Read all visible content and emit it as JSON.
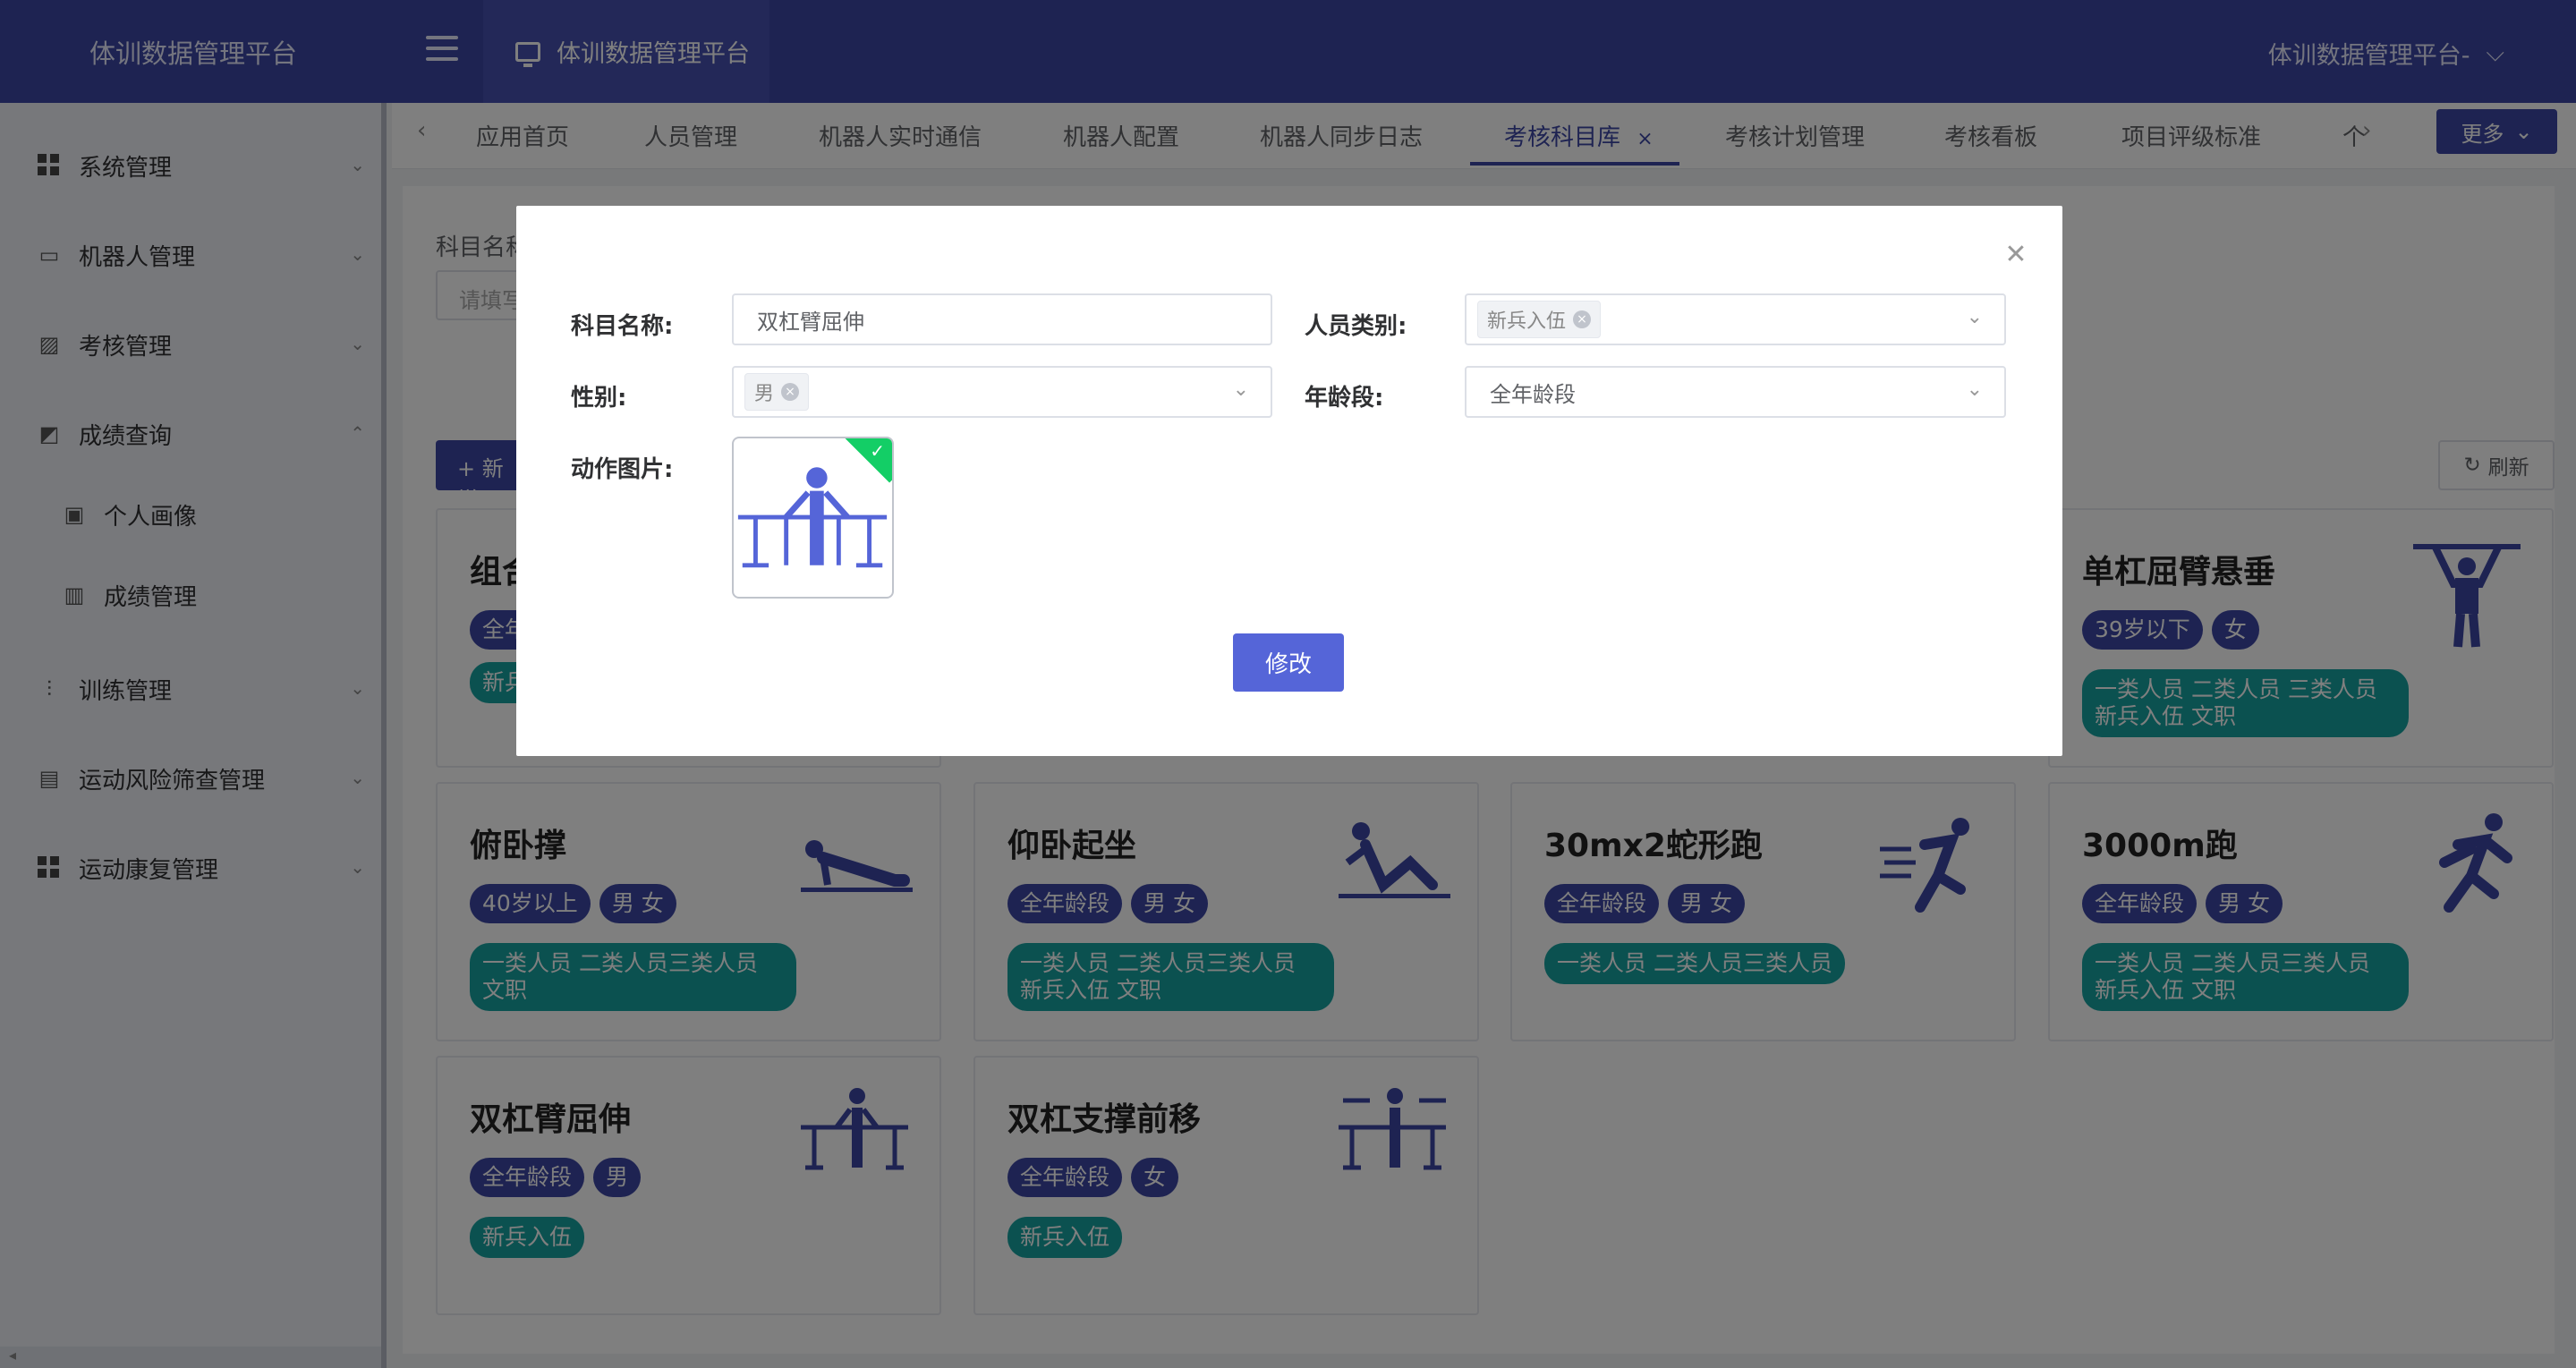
{
  "header": {
    "logo": "体训数据管理平台",
    "app_tab": "体训数据管理平台",
    "user": "体训数据管理平台-"
  },
  "sidebar": {
    "items": [
      {
        "label": "系统管理",
        "icon": "grid-icon"
      },
      {
        "label": "机器人管理",
        "icon": "monitor-icon"
      },
      {
        "label": "考核管理",
        "icon": "edit-icon"
      },
      {
        "label": "成绩查询",
        "icon": "chart-icon"
      },
      {
        "label": "个人画像",
        "icon": "profile-icon"
      },
      {
        "label": "成绩管理",
        "icon": "bar-chart-icon"
      },
      {
        "label": "训练管理",
        "icon": "sliders-icon"
      },
      {
        "label": "运动风险筛查管理",
        "icon": "list-icon"
      },
      {
        "label": "运动康复管理",
        "icon": "grid-icon"
      }
    ]
  },
  "tabs": [
    "应用首页",
    "人员管理",
    "机器人实时通信",
    "机器人配置",
    "机器人同步日志",
    "考核科目库",
    "考核计划管理",
    "考核看板",
    "项目评级标准",
    "个"
  ],
  "active_tab": "考核科目库",
  "more_label": "更多",
  "filter": {
    "label": "科目名称",
    "placeholder": "请填写"
  },
  "add_label": "+ 新增",
  "refresh_label": "刷新",
  "cards": [
    {
      "title": "组合",
      "tags": [
        "全年龄段"
      ],
      "teal": "新兵入伍"
    },
    {
      "title": "单杠屈臂悬垂",
      "tags": [
        "39岁以下",
        "女"
      ],
      "teal": "一类人员 二类人员 三类人员 新兵入伍 文职"
    },
    {
      "title": "俯卧撑",
      "tags": [
        "40岁以上",
        "男 女"
      ],
      "teal": "一类人员 二类人员三类人员 文职"
    },
    {
      "title": "仰卧起坐",
      "tags": [
        "全年龄段",
        "男 女"
      ],
      "teal": "一类人员 二类人员三类人员 新兵入伍 文职"
    },
    {
      "title": "30mx2蛇形跑",
      "tags": [
        "全年龄段",
        "男 女"
      ],
      "teal": "一类人员 二类人员三类人员"
    },
    {
      "title": "3000m跑",
      "tags": [
        "全年龄段",
        "男 女"
      ],
      "teal": "一类人员 二类人员三类人员 新兵入伍 文职"
    },
    {
      "title": "双杠臂屈伸",
      "tags": [
        "全年龄段",
        "男"
      ],
      "teal": "新兵入伍"
    },
    {
      "title": "双杠支撑前移",
      "tags": [
        "全年龄段",
        "女"
      ],
      "teal": "新兵入伍"
    }
  ],
  "modal": {
    "name_label": "科目名称:",
    "name_value": "双杠臂屈伸",
    "category_label": "人员类别:",
    "category_chip": "新兵入伍",
    "gender_label": "性别:",
    "gender_chip": "男",
    "age_label": "年龄段:",
    "age_value": "全年龄段",
    "image_label": "动作图片:",
    "submit_label": "修改"
  },
  "colors": {
    "primary": "#3d47a5",
    "teal": "#17a2a0",
    "success": "#13ce66"
  }
}
